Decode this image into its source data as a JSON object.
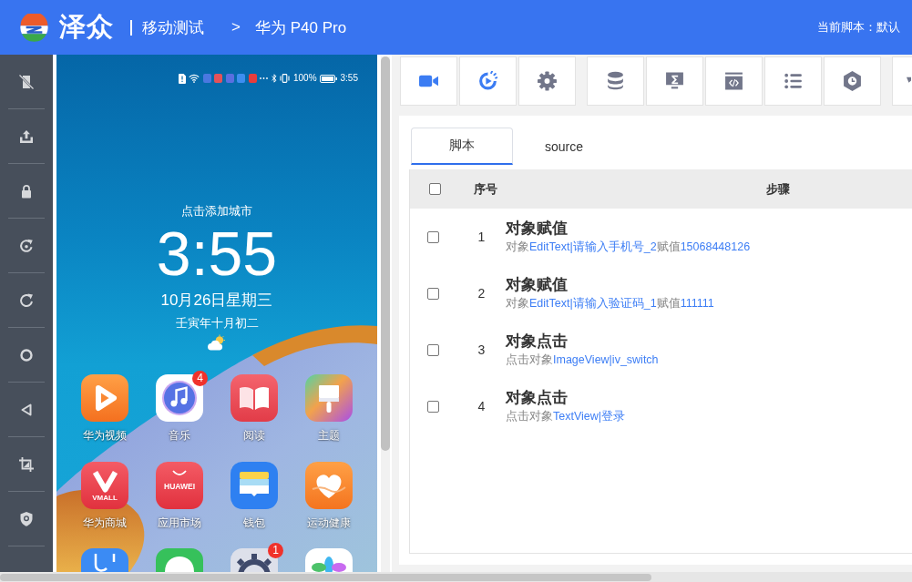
{
  "header": {
    "brand": "泽众",
    "breadcrumb": [
      {
        "kind": "section",
        "text": "移动测试"
      },
      {
        "kind": "separator",
        "text": ">"
      },
      {
        "kind": "device",
        "text": "华为 P40 Pro"
      }
    ],
    "current_script": "当前脚本：默认"
  },
  "side_tools": [
    {
      "kind": "screen_off"
    },
    {
      "kind": "upload"
    },
    {
      "kind": "lock"
    },
    {
      "kind": "rotate"
    },
    {
      "kind": "refresh"
    },
    {
      "kind": "home"
    },
    {
      "kind": "back"
    },
    {
      "kind": "crop"
    },
    {
      "kind": "shield_search"
    }
  ],
  "phone": {
    "status_bar": {
      "notifications": [
        {
          "color": "#4a78e0"
        },
        {
          "color": "#e4525a"
        },
        {
          "color": "#5a6fe0"
        },
        {
          "color": "#3d8ef0"
        },
        {
          "color": "#e83c3c"
        }
      ],
      "battery": "100%",
      "time": "3:55"
    },
    "lock_screen": {
      "city_prompt": "点击添加城市",
      "clock": "3:55",
      "date": "10月26日星期三",
      "lunar_date": "壬寅年十月初二"
    },
    "apps": [
      {
        "kind": "video",
        "label": "华为视频"
      },
      {
        "kind": "music",
        "label": "音乐",
        "badge": "4"
      },
      {
        "kind": "read",
        "label": "阅读"
      },
      {
        "kind": "theme",
        "label": "主题"
      },
      {
        "kind": "vmall",
        "label": "华为商城",
        "logo_text": "VMALL"
      },
      {
        "kind": "appstore",
        "label": "应用市场",
        "logo_text": "HUAWEI"
      },
      {
        "kind": "wallet",
        "label": "钱包"
      },
      {
        "kind": "health",
        "label": "运动健康"
      }
    ],
    "apps_partial_row": [
      {
        "kind": "assistant"
      },
      {
        "kind": "chat"
      },
      {
        "kind": "settings",
        "badge": "1"
      },
      {
        "kind": "gallery"
      }
    ]
  },
  "toolbar": {
    "groups": [
      {
        "buttons": [
          {
            "kind": "record",
            "color": "#3b7cf3"
          },
          {
            "kind": "replay",
            "color": "#3b7cf3"
          },
          {
            "kind": "settings",
            "color": "#72768a"
          }
        ]
      },
      {
        "buttons": [
          {
            "kind": "database",
            "color": "#72768a"
          },
          {
            "kind": "monitor",
            "color": "#72768a"
          },
          {
            "kind": "code",
            "color": "#72768a"
          },
          {
            "kind": "list",
            "color": "#72768a"
          },
          {
            "kind": "timer",
            "color": "#72768a"
          }
        ]
      },
      {
        "buttons": [
          {
            "kind": "filter",
            "color": "#72768a"
          }
        ]
      }
    ]
  },
  "tabs": [
    {
      "label": "脚本",
      "selected": true
    },
    {
      "label": "source",
      "selected": false
    }
  ],
  "table": {
    "select_all_checked": false,
    "columns": [
      "序号",
      "步骤"
    ],
    "rows": [
      {
        "checked": false,
        "index": "1",
        "title": "对象赋值",
        "detail": [
          {
            "kind": "plain",
            "text": "对象"
          },
          {
            "kind": "ref",
            "text": "EditText|请输入手机号_2"
          },
          {
            "kind": "plain",
            "text": "赋值"
          },
          {
            "kind": "ref",
            "text": "15068448126"
          }
        ]
      },
      {
        "checked": false,
        "index": "2",
        "title": "对象赋值",
        "detail": [
          {
            "kind": "plain",
            "text": "对象"
          },
          {
            "kind": "ref",
            "text": "EditText|请输入验证码_1"
          },
          {
            "kind": "plain",
            "text": "赋值"
          },
          {
            "kind": "ref",
            "text": "111111"
          }
        ]
      },
      {
        "checked": false,
        "index": "3",
        "title": "对象点击",
        "detail": [
          {
            "kind": "plain",
            "text": "点击对象"
          },
          {
            "kind": "ref",
            "text": "ImageView|iv_switch"
          }
        ]
      },
      {
        "checked": false,
        "index": "4",
        "title": "对象点击",
        "detail": [
          {
            "kind": "plain",
            "text": "点击对象"
          },
          {
            "kind": "ref",
            "text": "TextView|登录"
          }
        ]
      }
    ]
  }
}
